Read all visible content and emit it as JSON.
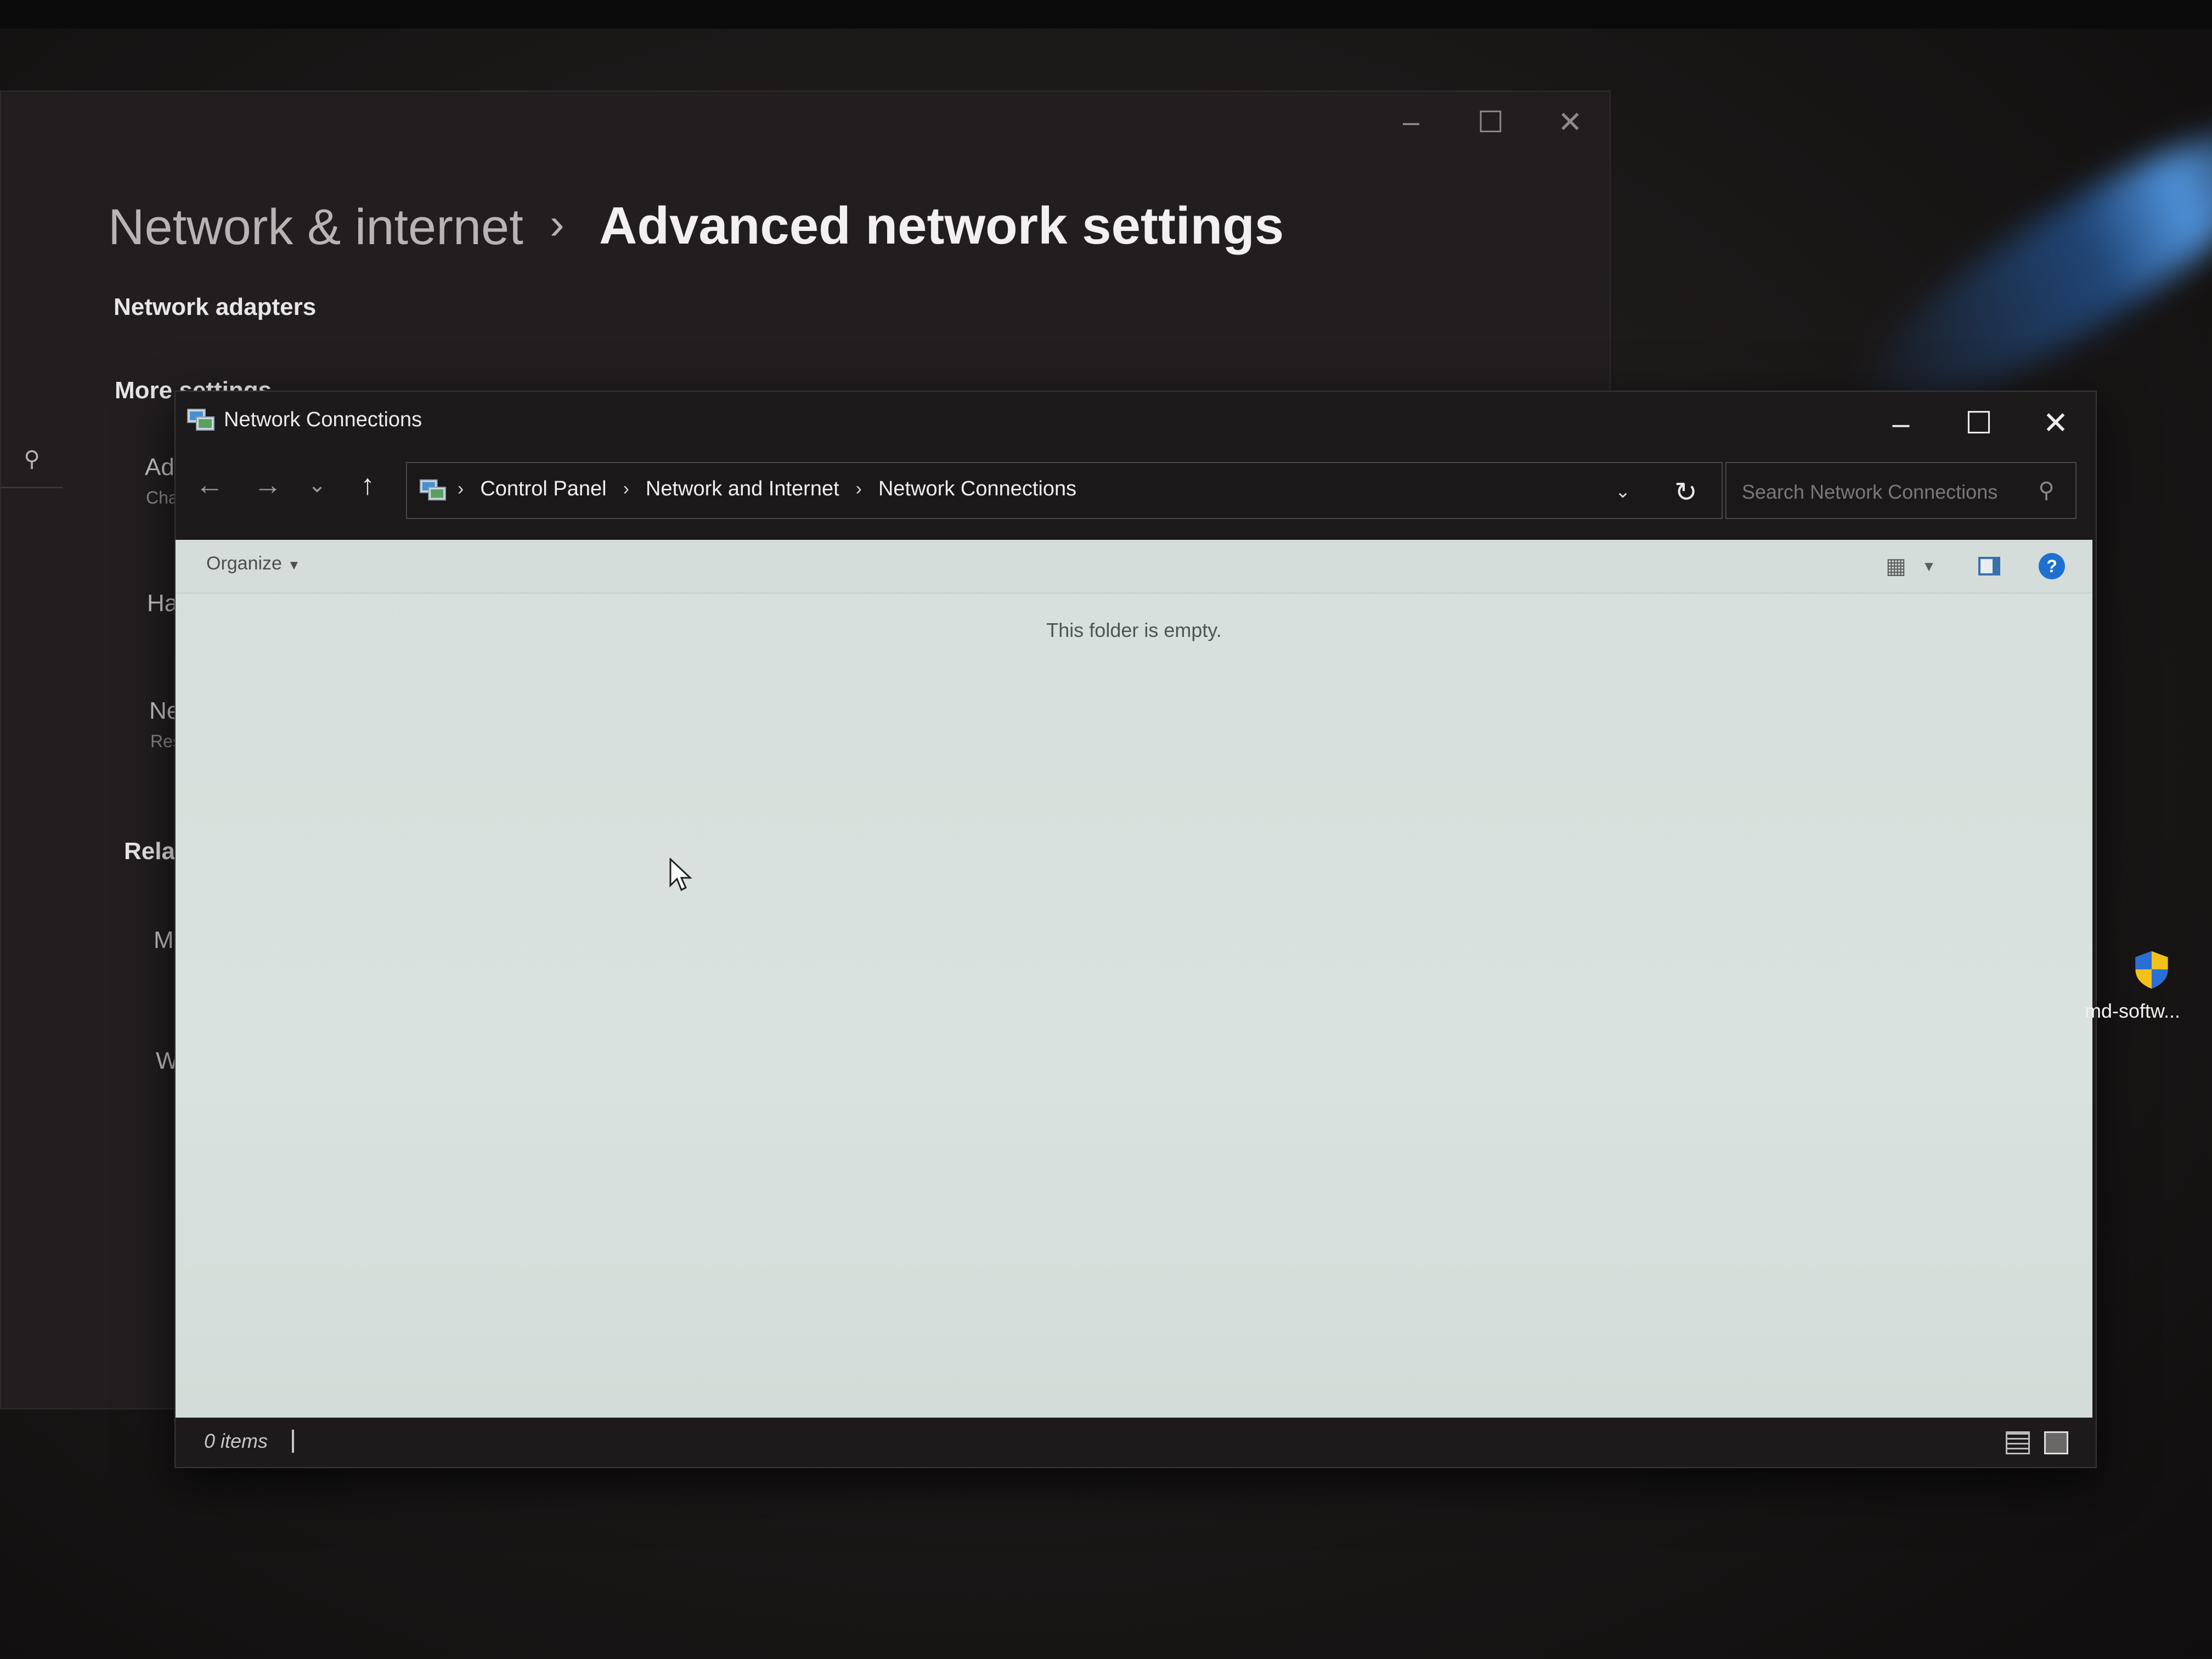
{
  "settings": {
    "breadcrumb_parent": "Network & internet",
    "breadcrumb_separator": "›",
    "breadcrumb_current": "Advanced network settings",
    "section_network_adapters": "Network adapters",
    "section_more_settings": "More settings",
    "item_1_title": "Ad",
    "item_1_sub": "Cha",
    "item_2_title": "Ha",
    "item_3_title": "Ne",
    "item_3_sub": "Res",
    "section_related": "Relat",
    "item_4_title": "Mo",
    "item_5_title": "Wi"
  },
  "window": {
    "title": "Network Connections"
  },
  "address_bar": {
    "crumbs": [
      "Control Panel",
      "Network and Internet",
      "Network Connections"
    ],
    "separator": "›"
  },
  "search": {
    "placeholder": "Search Network Connections"
  },
  "command_bar": {
    "organize_label": "Organize"
  },
  "content": {
    "empty_message": "This folder is empty."
  },
  "status_bar": {
    "item_count": "0 items"
  },
  "desktop": {
    "icon_label": "md-softw...",
    "icon_name": "uac-shield-icon"
  },
  "colors": {
    "accent_blue": "#1f6fd0",
    "content_bg": "#d6dfdb",
    "window_dark": "#1c1a1b"
  }
}
